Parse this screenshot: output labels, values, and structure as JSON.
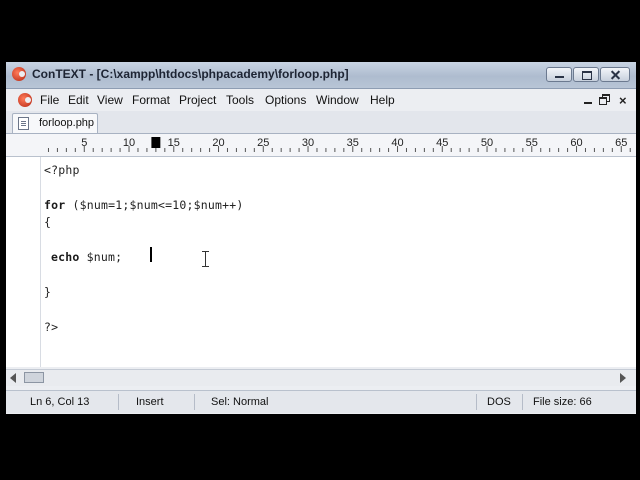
{
  "window": {
    "title": "ConTEXT - [C:\\xampp\\htdocs\\phpacademy\\forloop.php]"
  },
  "menu": {
    "items": [
      "File",
      "Edit",
      "View",
      "Format",
      "Project",
      "Tools",
      "Options",
      "Window",
      "Help"
    ]
  },
  "tabs": [
    {
      "label": "forloop.php",
      "active": true
    }
  ],
  "ruler": {
    "labels": [
      "5",
      "10",
      "15",
      "20",
      "25",
      "30",
      "35",
      "40",
      "45",
      "50",
      "55",
      "60",
      "65"
    ],
    "cursor_column": 13
  },
  "editor": {
    "lines": [
      "<?php",
      "",
      "for ($num=1;$num<=10;$num++)",
      "{",
      "",
      " echo $num; ",
      "",
      "}",
      "",
      "?>"
    ]
  },
  "status": {
    "position": "Ln 6, Col 13",
    "mode": "Insert",
    "selection": "Sel: Normal",
    "line_endings": "DOS",
    "file_size": "File size: 66"
  },
  "icons": {
    "app": "context-logo-icon",
    "file": "document-icon"
  }
}
